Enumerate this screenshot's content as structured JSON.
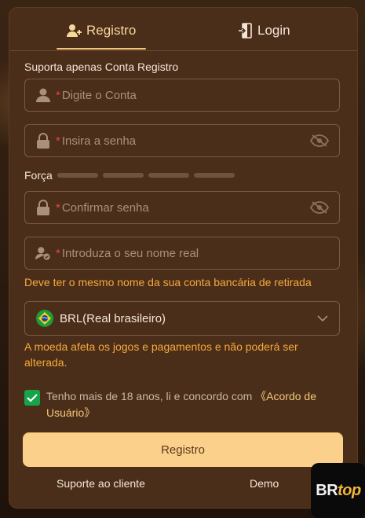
{
  "tabs": {
    "register_label": "Registro",
    "login_label": "Login"
  },
  "form": {
    "supported_label": "Suporta apenas Conta Registro",
    "account": {
      "required_mark": "*",
      "placeholder": "Digite o Conta",
      "value": ""
    },
    "password": {
      "required_mark": "*",
      "placeholder": "Insira a senha",
      "value": ""
    },
    "strength_label": "Força",
    "confirm": {
      "required_mark": "*",
      "placeholder": "Confirmar senha",
      "value": ""
    },
    "real_name": {
      "required_mark": "*",
      "placeholder": "Introduza o seu nome real",
      "value": ""
    },
    "real_name_hint": "Deve ter o mesmo nome da sua conta bancária de retirada",
    "currency": {
      "selected": "BRL(Real brasileiro)"
    },
    "currency_hint": "A moeda afeta os jogos e pagamentos e não poderá ser alterada.",
    "agree_text": "Tenho mais de 18 anos, li e concordo com ",
    "agree_link": "《Acordo de Usuário》",
    "agree_checked": true,
    "submit_label": "Registro"
  },
  "footer": {
    "support_label": "Suporte ao cliente",
    "demo_label": "Demo"
  },
  "logo": {
    "part1": "BR",
    "part2": "top"
  },
  "colors": {
    "panel": "#4b2e1a",
    "accent": "#f3c879",
    "warning": "#f5a93a",
    "required": "#e04a3a",
    "checkbox": "#16a34a",
    "button": "#fbd08a"
  }
}
